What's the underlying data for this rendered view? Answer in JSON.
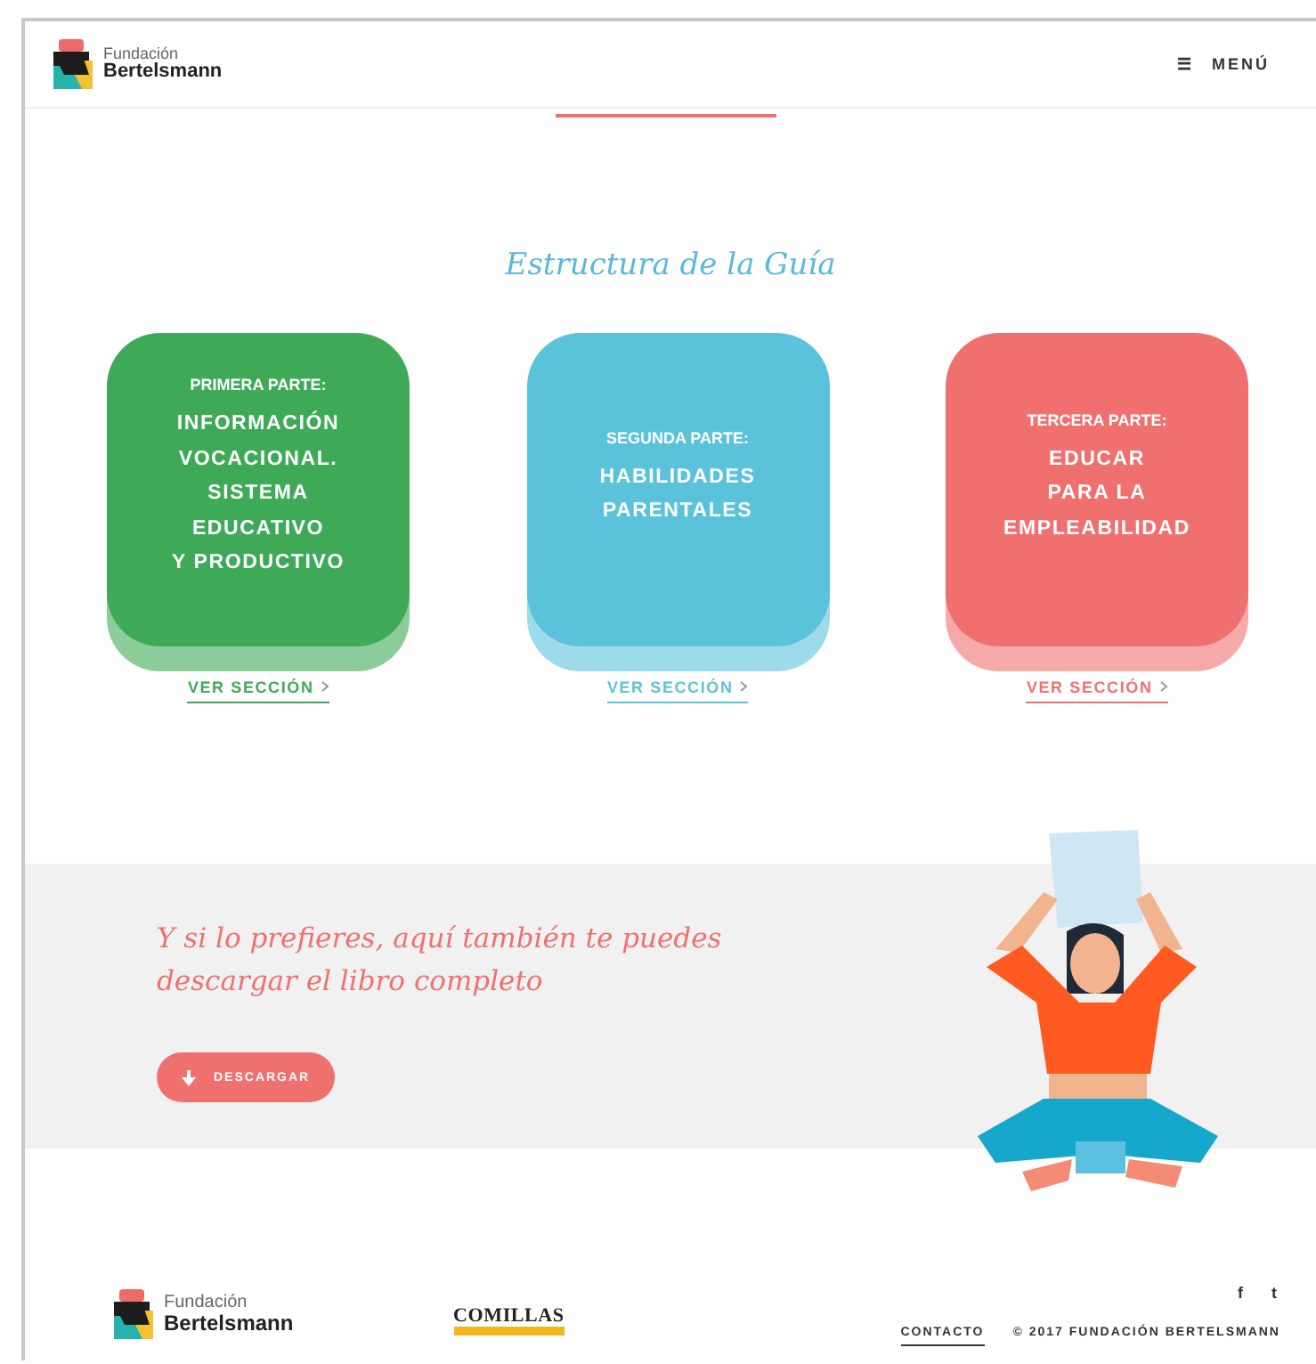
{
  "header": {
    "logo": {
      "line1": "Fundación",
      "line2": "Bertelsmann"
    },
    "menu": {
      "icon": "☰",
      "label": "MENÚ"
    }
  },
  "section": {
    "title": "Estructura de la Guía",
    "cards": [
      {
        "kicker": "PRIMERA PARTE:",
        "lines": [
          "INFORMACIÓN",
          "VOCACIONAL.",
          "SISTEMA",
          "EDUCATIVO",
          "Y PRODUCTIVO"
        ],
        "color": "#3eaa58",
        "link": "VER SECCIÓN"
      },
      {
        "kicker": "SEGUNDA PARTE:",
        "lines": [
          "HABILIDADES",
          "PARENTALES"
        ],
        "color": "#5bc2dc",
        "link": "VER SECCIÓN"
      },
      {
        "kicker": "TERCERA PARTE:",
        "lines": [
          "EDUCAR",
          "PARA LA",
          "EMPLEABILIDAD"
        ],
        "color": "#f07070",
        "link": "VER SECCIÓN"
      }
    ]
  },
  "download": {
    "text": "Y si lo prefieres, aquí también te puedes descargar el libro completo",
    "button": "DESCARGAR"
  },
  "footer": {
    "logo": {
      "line1": "Fundación",
      "line2": "Bertelsmann"
    },
    "partner": "COMILLAS",
    "social": [
      "f",
      "t"
    ],
    "contact": "CONTACTO",
    "copyright": "© 2017 FUNDACIÓN BERTELSMANN"
  }
}
